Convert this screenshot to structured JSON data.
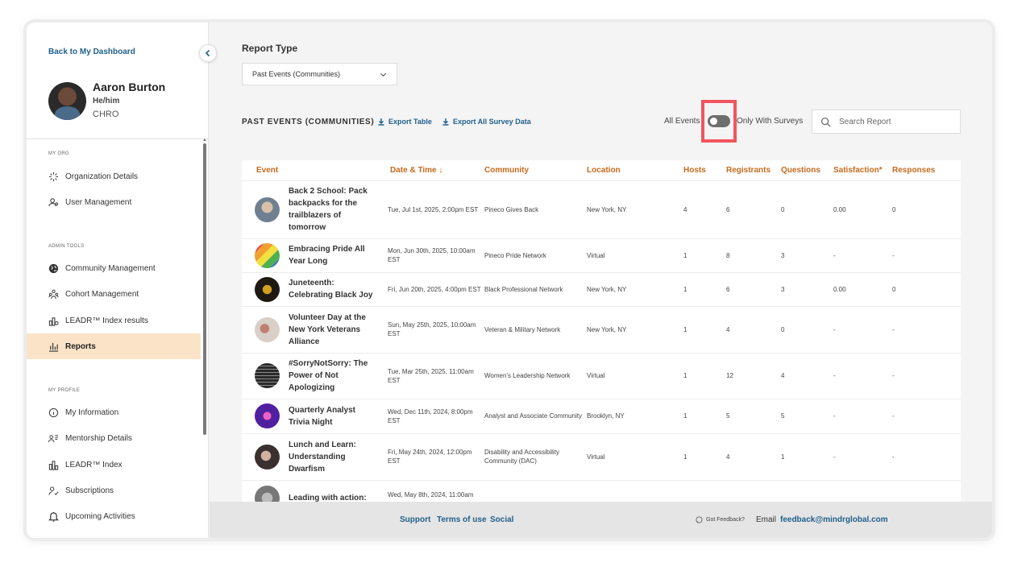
{
  "sidebar": {
    "back_link": "Back to My Dashboard",
    "user": {
      "name": "Aaron Burton",
      "pronouns": "He/him",
      "role": "CHRO"
    },
    "sections": {
      "my_org": "MY ORG",
      "admin_tools": "ADMIN TOOLS",
      "my_profile": "MY PROFILE"
    },
    "items": [
      {
        "label": "Organization Details",
        "icon": "sparkle-icon"
      },
      {
        "label": "User Management",
        "icon": "user-settings-icon"
      },
      {
        "label": "Community Management",
        "icon": "globe-icon"
      },
      {
        "label": "Cohort Management",
        "icon": "people-group-icon"
      },
      {
        "label": "LEADR™ Index results",
        "icon": "chart-icon"
      },
      {
        "label": "Reports",
        "icon": "bar-chart-icon",
        "active": true
      },
      {
        "label": "My Information",
        "icon": "info-icon"
      },
      {
        "label": "Mentorship Details",
        "icon": "mentorship-icon"
      },
      {
        "label": "LEADR™ Index",
        "icon": "index-icon"
      },
      {
        "label": "Subscriptions",
        "icon": "subscription-icon"
      },
      {
        "label": "Upcoming Activities",
        "icon": "bell-icon"
      }
    ]
  },
  "main": {
    "report_type_label": "Report Type",
    "report_type_value": "Past Events (Communities)",
    "section_title": "PAST EVENTS (COMMUNITIES)",
    "export_table": "Export Table",
    "export_survey": "Export All Survey Data",
    "toggle_left": "All Events",
    "toggle_right": "Only With Surveys",
    "search_placeholder": "Search Report",
    "columns": [
      "Event",
      "Date & Time ↓",
      "Community",
      "Location",
      "Hosts",
      "Registrants",
      "Questions",
      "Satisfaction*",
      "Responses"
    ],
    "rows": [
      {
        "event": "Back 2 School: Pack backpacks for the trailblazers of tomorrow",
        "date": "Tue, Jul 1st, 2025, 2:00pm EST",
        "community": "Pineco Gives Back",
        "location": "New York, NY",
        "hosts": "4",
        "registrants": "6",
        "questions": "0",
        "satisfaction": "0.00",
        "responses": "0",
        "thumb": "#8a9aa8"
      },
      {
        "event": "Embracing Pride All Year Long",
        "date": "Mon, Jun 30th, 2025, 10:00am EST",
        "community": "Pineco Pride Network",
        "location": "Virtual",
        "hosts": "1",
        "registrants": "8",
        "questions": "3",
        "satisfaction": "-",
        "responses": "-",
        "thumb": "#e8c23a"
      },
      {
        "event": "Juneteenth: Celebrating Black Joy",
        "date": "Fri, Jun 20th, 2025, 4:00pm EST",
        "community": "Black Professional Network",
        "location": "New York, NY",
        "hosts": "1",
        "registrants": "6",
        "questions": "3",
        "satisfaction": "0.00",
        "responses": "0",
        "thumb": "#2a2418"
      },
      {
        "event": "Volunteer Day at the New York Veterans Alliance",
        "date": "Sun, May 25th, 2025, 10:00am EST",
        "community": "Veteran & Military Network",
        "location": "New York, NY",
        "hosts": "1",
        "registrants": "4",
        "questions": "0",
        "satisfaction": "-",
        "responses": "-",
        "thumb": "#b9a8a0"
      },
      {
        "event": "#SorryNotSorry: The Power of Not Apologizing",
        "date": "Tue, Mar 25th, 2025, 11:00am EST",
        "community": "Women's Leadership Network",
        "location": "Virtual",
        "hosts": "1",
        "registrants": "12",
        "questions": "4",
        "satisfaction": "-",
        "responses": "-",
        "thumb": "#333333"
      },
      {
        "event": "Quarterly Analyst Trivia Night",
        "date": "Wed, Dec 11th, 2024, 8:00pm EST",
        "community": "Analyst and Associate Community",
        "location": "Brooklyn, NY",
        "hosts": "1",
        "registrants": "5",
        "questions": "5",
        "satisfaction": "-",
        "responses": "-",
        "thumb": "#7a2a8a"
      },
      {
        "event": "Lunch and Learn: Understanding Dwarfism",
        "date": "Fri, May 24th, 2024, 12:00pm EST",
        "community": "Disability and Accessibility Community (DAC)",
        "location": "Virtual",
        "hosts": "1",
        "registrants": "4",
        "questions": "1",
        "satisfaction": "-",
        "responses": "-",
        "thumb": "#6a5a50"
      },
      {
        "event": "Leading with action:",
        "date": "Wed, May 8th, 2024, 11:00am",
        "community": "",
        "location": "",
        "hosts": "",
        "registrants": "",
        "questions": "",
        "satisfaction": "",
        "responses": "",
        "thumb": "#9a9a9a"
      }
    ]
  },
  "footer": {
    "support": "Support",
    "terms": "Terms of use",
    "social": "Social",
    "got_feedback": "Got Feedback?",
    "email_label": "Email",
    "email": "feedback@mindrglobal.com"
  },
  "colors": {
    "accent": "#c8691c",
    "link": "#1f5f8b",
    "active_bg": "#fbe3c8",
    "highlight": "#f0555f"
  }
}
